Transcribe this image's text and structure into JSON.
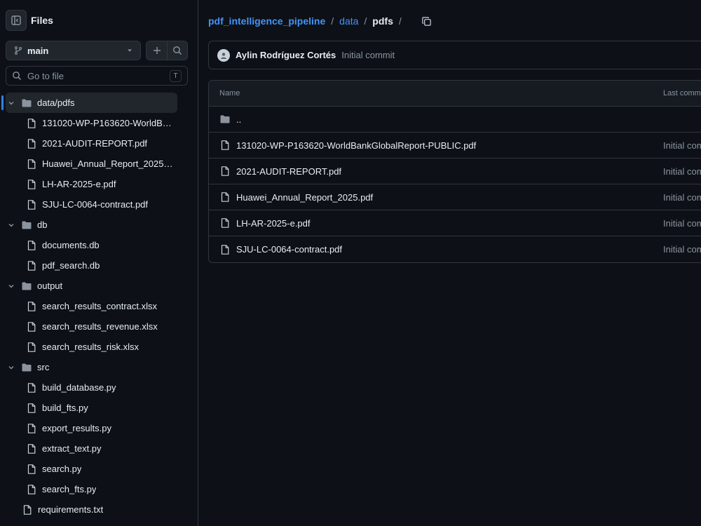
{
  "sidebar": {
    "title": "Files",
    "branch": "main",
    "goto_placeholder": "Go to file",
    "goto_shortcut": "T",
    "tree": [
      {
        "label": "data/pdfs",
        "type": "folder",
        "depth": 0,
        "expanded": true,
        "active": true
      },
      {
        "label": "131020-WP-P163620-WorldBankGlobalReport-PUBLIC.pdf",
        "display": "131020-WP-P163620-WorldBan...",
        "type": "file",
        "depth": 1
      },
      {
        "label": "2021-AUDIT-REPORT.pdf",
        "type": "file",
        "depth": 1
      },
      {
        "label": "Huawei_Annual_Report_2025.pdf",
        "type": "file",
        "depth": 1
      },
      {
        "label": "LH-AR-2025-e.pdf",
        "type": "file",
        "depth": 1
      },
      {
        "label": "SJU-LC-0064-contract.pdf",
        "type": "file",
        "depth": 1
      },
      {
        "label": "db",
        "type": "folder",
        "depth": 0,
        "expanded": true
      },
      {
        "label": "documents.db",
        "type": "file",
        "depth": 1
      },
      {
        "label": "pdf_search.db",
        "type": "file",
        "depth": 1
      },
      {
        "label": "output",
        "type": "folder",
        "depth": 0,
        "expanded": true
      },
      {
        "label": "search_results_contract.xlsx",
        "type": "file",
        "depth": 1
      },
      {
        "label": "search_results_revenue.xlsx",
        "type": "file",
        "depth": 1
      },
      {
        "label": "search_results_risk.xlsx",
        "type": "file",
        "depth": 1
      },
      {
        "label": "src",
        "type": "folder",
        "depth": 0,
        "expanded": true
      },
      {
        "label": "build_database.py",
        "type": "file",
        "depth": 1
      },
      {
        "label": "build_fts.py",
        "type": "file",
        "depth": 1
      },
      {
        "label": "export_results.py",
        "type": "file",
        "depth": 1
      },
      {
        "label": "extract_text.py",
        "type": "file",
        "depth": 1
      },
      {
        "label": "search.py",
        "type": "file",
        "depth": 1
      },
      {
        "label": "search_fts.py",
        "type": "file",
        "depth": 1
      },
      {
        "label": "requirements.txt",
        "type": "file",
        "depth": 0
      }
    ]
  },
  "breadcrumb": {
    "repo": "pdf_intelligence_pipeline",
    "folder": "data",
    "current": "pdfs",
    "sep": "/"
  },
  "commit": {
    "author": "Aylin Rodríguez Cortés",
    "message": "Initial commit"
  },
  "file_table": {
    "headers": {
      "name": "Name",
      "last_commit": "Last commi"
    },
    "rows": [
      {
        "name": "..",
        "type": "folder",
        "commit": ""
      },
      {
        "name": "131020-WP-P163620-WorldBankGlobalReport-PUBLIC.pdf",
        "type": "file",
        "commit": "Initial comm"
      },
      {
        "name": "2021-AUDIT-REPORT.pdf",
        "type": "file",
        "commit": "Initial comm"
      },
      {
        "name": "Huawei_Annual_Report_2025.pdf",
        "type": "file",
        "commit": "Initial comm"
      },
      {
        "name": "LH-AR-2025-e.pdf",
        "type": "file",
        "commit": "Initial comm"
      },
      {
        "name": "SJU-LC-0064-contract.pdf",
        "type": "file",
        "commit": "Initial comm"
      }
    ]
  },
  "colors": {
    "background": "#0d1117",
    "link": "#4493f8",
    "border": "#30363d",
    "muted": "#8b949e",
    "active_indicator": "#2f81f7"
  }
}
